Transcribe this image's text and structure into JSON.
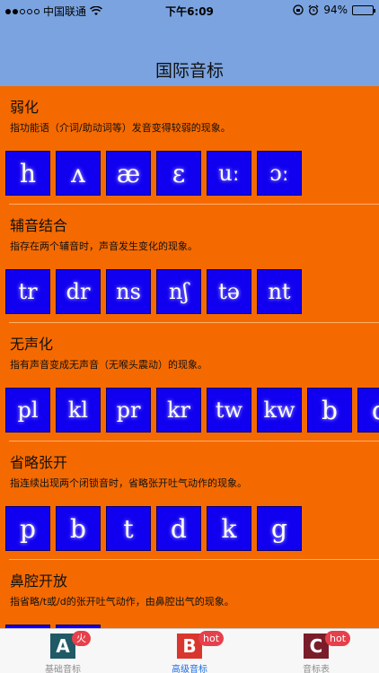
{
  "status_bar": {
    "carrier": "中国联通",
    "time": "下午6:09",
    "battery": "94%",
    "battery_level": 0.94
  },
  "nav": {
    "title": "国际音标"
  },
  "sections": [
    {
      "title": "弱化",
      "description": "指功能语（介词/助动词等）发音变得较弱的现象。",
      "symbols": [
        "h",
        "ʌ",
        "æ",
        "ɛ",
        "uː",
        "ɔː"
      ]
    },
    {
      "title": "辅音结合",
      "description": "指存在两个辅音时，声音发生变化的现象。",
      "symbols": [
        "tr",
        "dr",
        "ns",
        "nʃ",
        "tə",
        "nt"
      ]
    },
    {
      "title": "无声化",
      "description": "指有声音变成无声音（无喉头震动）的现象。",
      "symbols": [
        "pl",
        "kl",
        "pr",
        "kr",
        "tw",
        "kw",
        "b",
        "d"
      ]
    },
    {
      "title": "省略张开",
      "description": "指连续出现两个闭锁音时，省略张开吐气动作的现象。",
      "symbols": [
        "p",
        "b",
        "t",
        "d",
        "k",
        "g"
      ]
    },
    {
      "title": "鼻腔开放",
      "description": "指省略/t或/d的张开吐气动作，由鼻腔出气的现象。",
      "symbols": [
        "",
        ""
      ]
    }
  ],
  "tabbar": {
    "tabs": [
      {
        "label": "基础音标",
        "icon_letter": "A",
        "icon": "letter-a-icon",
        "badge": "火",
        "active": false
      },
      {
        "label": "高级音标",
        "icon_letter": "B",
        "icon": "letter-b-icon",
        "badge": "hot",
        "active": true
      },
      {
        "label": "音标表",
        "icon_letter": "C",
        "icon": "letter-c-icon",
        "badge": "hot",
        "active": false
      }
    ]
  },
  "colors": {
    "background": "#f56a00",
    "header": "#7ba3df",
    "tile": "#1100f0",
    "active_tab": "#1e6fe3",
    "badge": "#e6404b"
  }
}
